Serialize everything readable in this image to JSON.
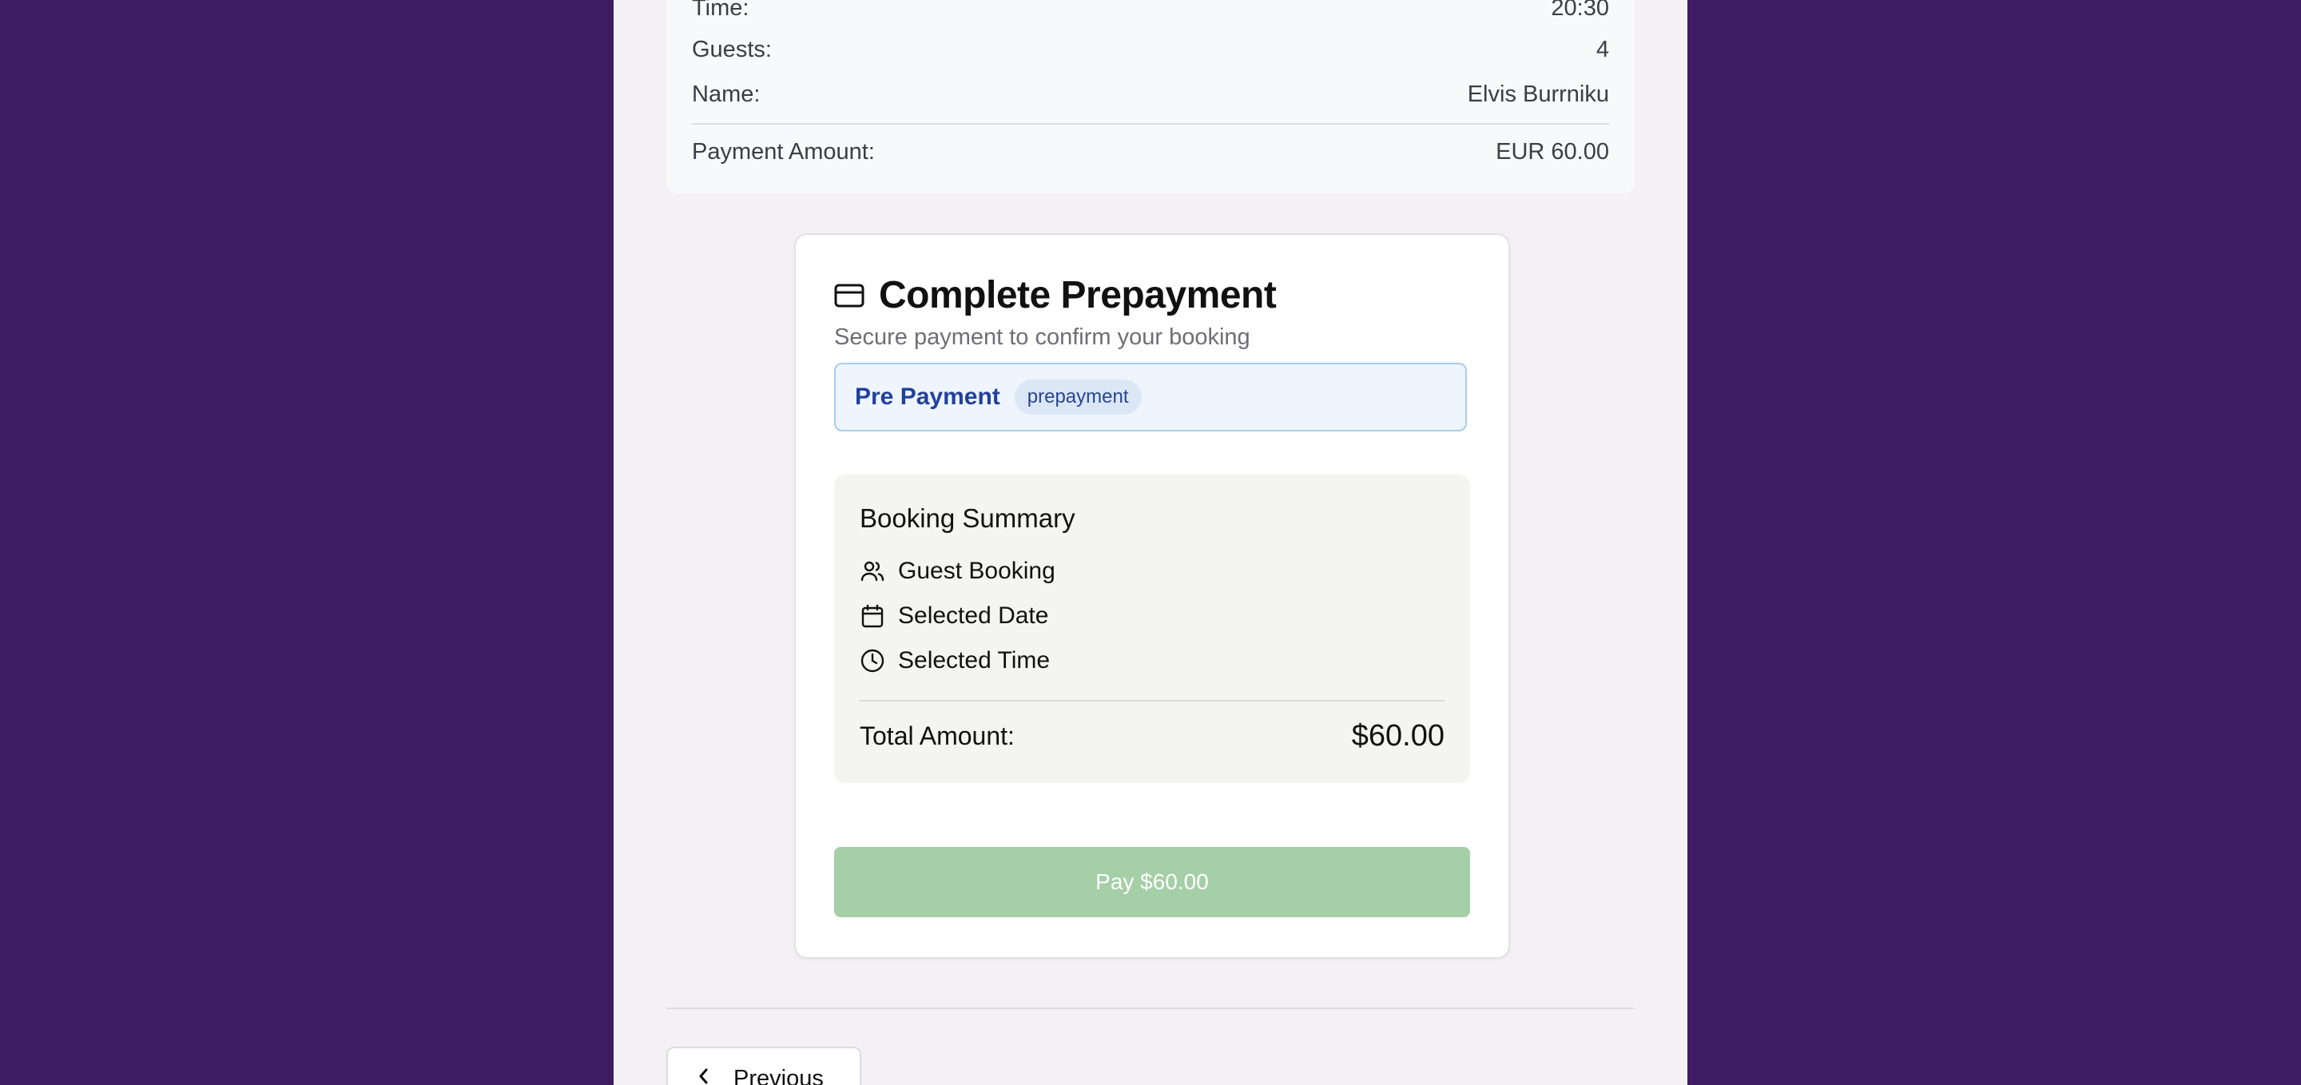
{
  "details": {
    "time_label": "Time:",
    "time_value": "20:30",
    "guests_label": "Guests:",
    "guests_value": "4",
    "name_label": "Name:",
    "name_value": "Elvis Burrniku",
    "payment_label": "Payment Amount:",
    "payment_value": "EUR 60.00"
  },
  "prepayment": {
    "title": "Complete Prepayment",
    "subtitle": "Secure payment to confirm your booking",
    "type_label": "Pre Payment",
    "type_badge": "prepayment",
    "icon": "credit-card-icon"
  },
  "summary": {
    "title": "Booking Summary",
    "items": [
      {
        "icon": "users-icon",
        "label": "Guest Booking"
      },
      {
        "icon": "calendar-icon",
        "label": "Selected Date"
      },
      {
        "icon": "clock-icon",
        "label": "Selected Time"
      }
    ],
    "total_label": "Total Amount:",
    "total_value": "$60.00"
  },
  "pay_button_label": "Pay $60.00",
  "previous_button_label": "Previous",
  "colors": {
    "background": "#3d1c64",
    "pay_button": "#a5cfa7",
    "badge_text": "#23409b"
  }
}
